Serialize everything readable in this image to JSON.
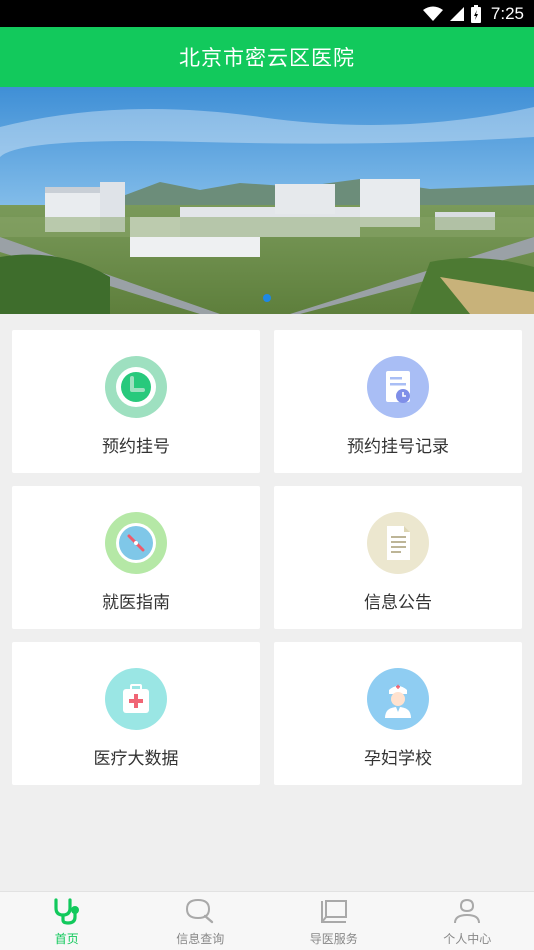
{
  "status_bar": {
    "time": "7:25"
  },
  "header": {
    "title": "北京市密云区医院"
  },
  "banner": {
    "slide_count": 1,
    "active_slide": 1
  },
  "menu": [
    {
      "label": "预约挂号",
      "icon": "clock-icon",
      "color": "#9ee0c0"
    },
    {
      "label": "预约挂号记录",
      "icon": "document-clock-icon",
      "color": "#a9bef5"
    },
    {
      "label": "就医指南",
      "icon": "compass-icon",
      "color": "#b5e8a6"
    },
    {
      "label": "信息公告",
      "icon": "notice-icon",
      "color": "#ece7cf"
    },
    {
      "label": "医疗大数据",
      "icon": "medical-kit-icon",
      "color": "#9ae6e4"
    },
    {
      "label": "孕妇学校",
      "icon": "nurse-icon",
      "color": "#8fcdf2"
    }
  ],
  "tabbar": {
    "active_color": "#12c95c",
    "items": [
      {
        "label": "首页",
        "icon": "stethoscope-icon",
        "active": true
      },
      {
        "label": "信息查询",
        "icon": "search-icon",
        "active": false
      },
      {
        "label": "导医服务",
        "icon": "guide-icon",
        "active": false
      },
      {
        "label": "个人中心",
        "icon": "person-icon",
        "active": false
      }
    ]
  }
}
